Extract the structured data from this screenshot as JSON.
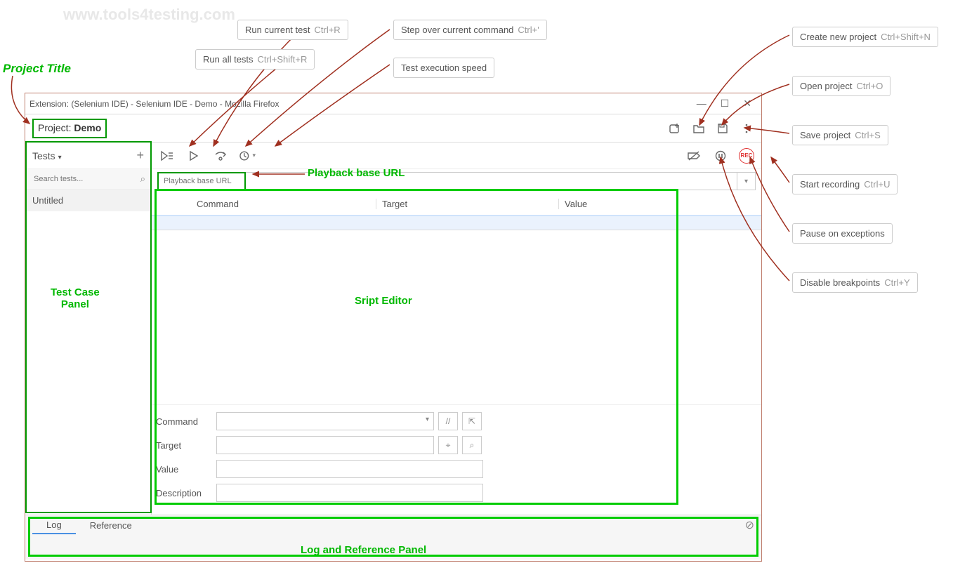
{
  "watermarks": [
    "www.tools4testing.com",
    "www.tools4testing.com",
    "www.tools4testing.com",
    "www.tools4testing.com"
  ],
  "annotations": {
    "project_title": "Project Title",
    "playback_url": "Playback base URL",
    "test_panel": "Test Case\nPanel",
    "script_editor": "Sript Editor",
    "log_panel": "Log and Reference Panel"
  },
  "tooltips": {
    "run_current": {
      "label": "Run current test",
      "shortcut": "Ctrl+R"
    },
    "run_all": {
      "label": "Run all tests",
      "shortcut": "Ctrl+Shift+R"
    },
    "step_over": {
      "label": "Step over current command",
      "shortcut": "Ctrl+'"
    },
    "exec_speed": {
      "label": "Test execution speed",
      "shortcut": ""
    },
    "create_proj": {
      "label": "Create new project",
      "shortcut": "Ctrl+Shift+N"
    },
    "open_proj": {
      "label": "Open project",
      "shortcut": "Ctrl+O"
    },
    "save_proj": {
      "label": "Save project",
      "shortcut": "Ctrl+S"
    },
    "start_rec": {
      "label": "Start recording",
      "shortcut": "Ctrl+U"
    },
    "pause_exc": {
      "label": "Pause on exceptions",
      "shortcut": ""
    },
    "disable_bp": {
      "label": "Disable breakpoints",
      "shortcut": "Ctrl+Y"
    }
  },
  "window": {
    "title": "Extension: (Selenium IDE) - Selenium IDE - Demo - Mozilla Firefox",
    "controls": {
      "min": "—",
      "max": "☐",
      "close": "✕"
    },
    "project_label": "Project:",
    "project_name": "Demo",
    "sidebar": {
      "tests_label": "Tests",
      "search_placeholder": "Search tests...",
      "items": [
        "Untitled"
      ]
    },
    "url_placeholder": "Playback base URL",
    "grid": {
      "col_command": "Command",
      "col_target": "Target",
      "col_value": "Value"
    },
    "form": {
      "command": "Command",
      "target": "Target",
      "value": "Value",
      "description": "Description"
    },
    "tabs": {
      "log": "Log",
      "reference": "Reference"
    },
    "rec_label": "REC"
  }
}
